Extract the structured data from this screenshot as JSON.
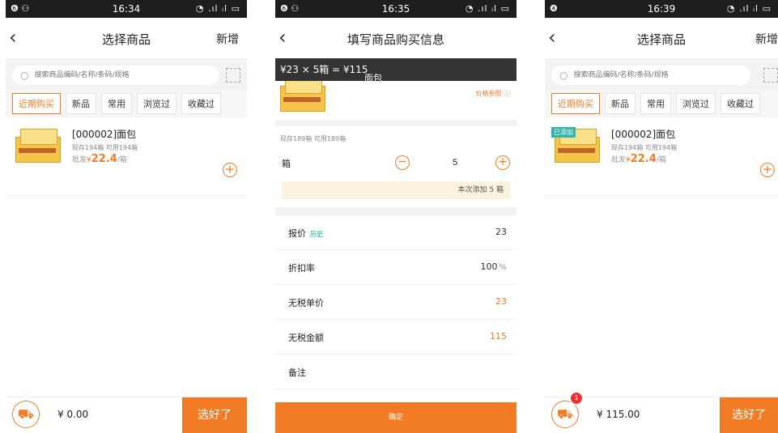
{
  "colors": {
    "accent": "#f27c25",
    "added_tag": "#2fb4a7",
    "badge": "#e8332f"
  },
  "panel1": {
    "status": {
      "left": "❻ ⚇",
      "time": "16:34",
      "right": "◔ .ıl ᵢl ▭"
    },
    "nav": {
      "title": "选择商品",
      "action": "新增"
    },
    "search": {
      "placeholder": "搜索商品编码/名称/条码/规格"
    },
    "tabs": [
      "近期购买",
      "新品",
      "常用",
      "浏览过",
      "收藏过"
    ],
    "product": {
      "name": "[000002]面包",
      "stock": "现存194箱   可用194箱",
      "price_prefix": "批发",
      "currency": "¥",
      "price": "22.4",
      "unit": "/箱"
    },
    "bottom": {
      "total": "¥ 0.00",
      "confirm": "选好了"
    }
  },
  "panel2": {
    "status": {
      "left": "❻ ⚇",
      "time": "16:35",
      "right": "◔ .ıl ᵢl ▭"
    },
    "nav": {
      "title": "填写商品购买信息"
    },
    "formula": "¥23 × 5箱 = ¥115",
    "product_name": "面包",
    "price_ref": "价格参照 ⓘ",
    "stock": "现存189箱   可用189箱",
    "unit": "箱",
    "quantity": "5",
    "add_note": "本次添加 5 箱",
    "fields": [
      {
        "label": "报价",
        "tag": "历史",
        "value": "23",
        "pct": ""
      },
      {
        "label": "折扣率",
        "tag": "",
        "value": "100",
        "pct": "%"
      },
      {
        "label": "无税单价",
        "tag": "",
        "value": "23",
        "pct": ""
      },
      {
        "label": "无税金额",
        "tag": "",
        "value": "115",
        "pct": ""
      },
      {
        "label": "备注",
        "tag": "",
        "value": "",
        "pct": ""
      }
    ],
    "submit": "确定"
  },
  "panel3": {
    "status": {
      "left": "❹",
      "time": "16:39",
      "right": "◔ .ıl ᵢl ▭"
    },
    "nav": {
      "title": "选择商品",
      "action": "新增"
    },
    "search": {
      "placeholder": "搜索商品编码/名称/条码/规格"
    },
    "tabs": [
      "近期购买",
      "新品",
      "常用",
      "浏览过",
      "收藏过"
    ],
    "product": {
      "added_tag": "已添加",
      "name": "[000002]面包",
      "stock": "现存194箱   可用194箱",
      "price_prefix": "批发",
      "currency": "¥",
      "price": "22.4",
      "unit": "/箱"
    },
    "bottom": {
      "badge": "1",
      "total": "¥ 115.00",
      "confirm": "选好了"
    }
  }
}
